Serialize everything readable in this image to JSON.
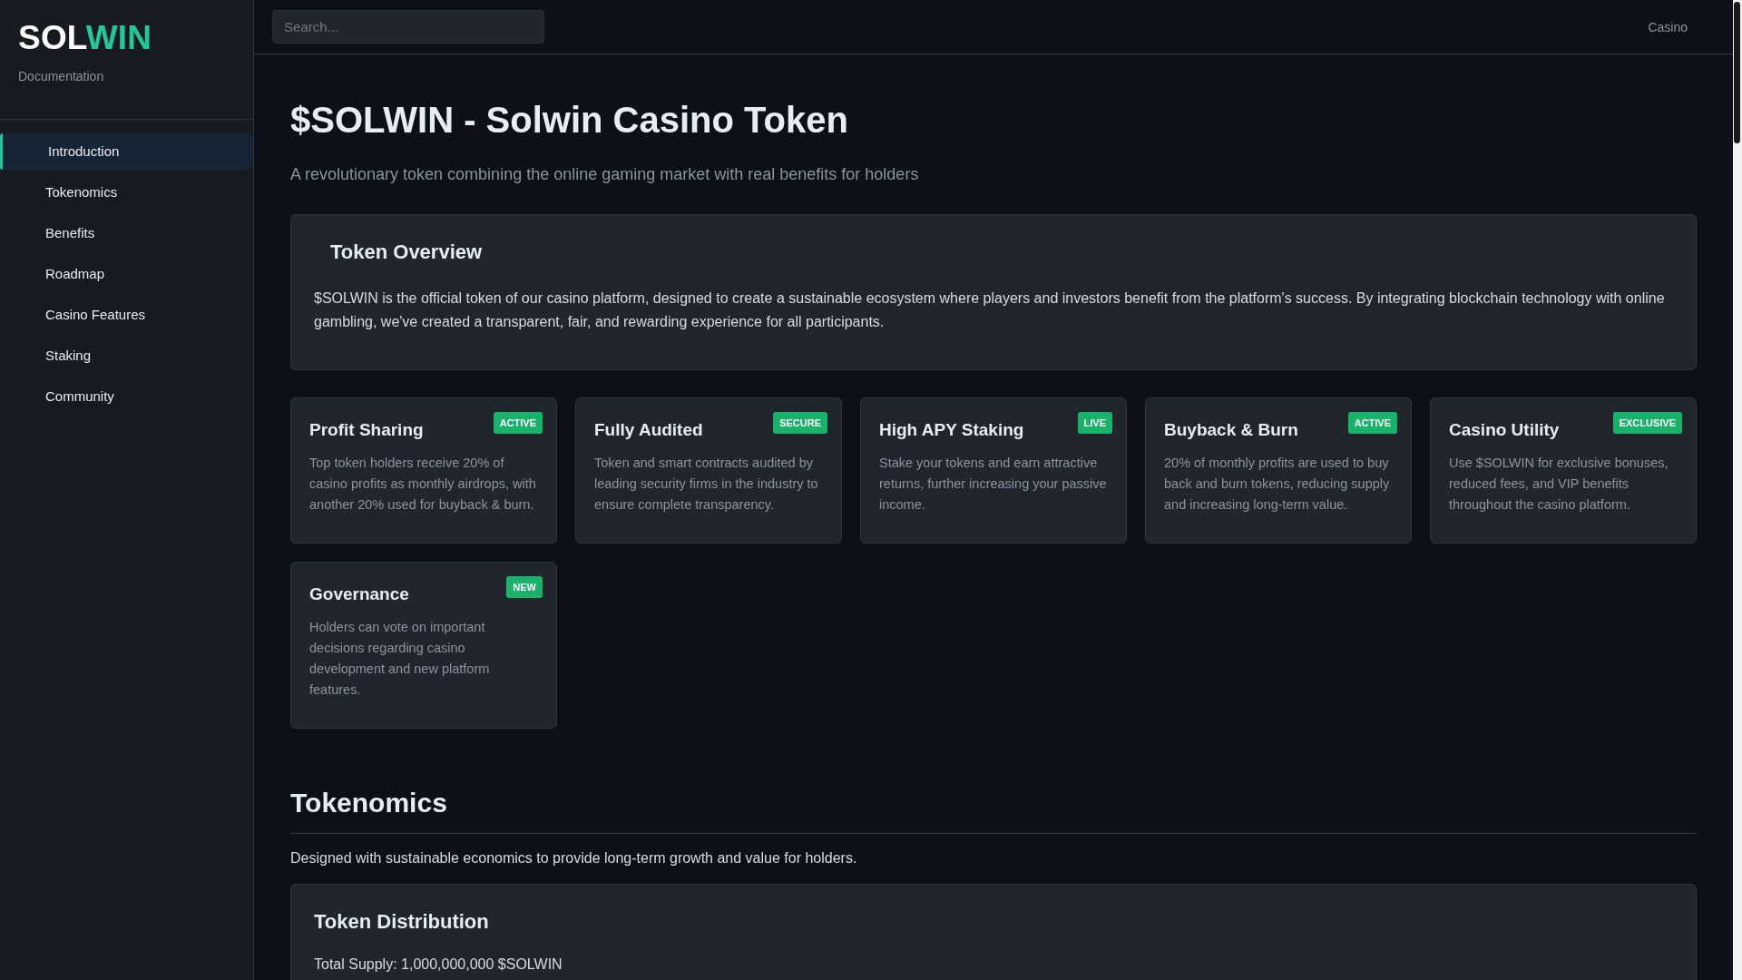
{
  "sidebar": {
    "logo": {
      "parts": [
        {
          "text": "SOL",
          "accent": false
        },
        {
          "text": "WIN",
          "accent": true
        }
      ]
    },
    "subtitle": "Documentation",
    "nav": [
      {
        "label": "Introduction",
        "selected": true
      },
      {
        "label": "Tokenomics",
        "selected": false
      },
      {
        "label": "Benefits",
        "selected": false
      },
      {
        "label": "Roadmap",
        "selected": false
      },
      {
        "label": "Casino Features",
        "selected": false
      },
      {
        "label": "Staking",
        "selected": false
      },
      {
        "label": "Community",
        "selected": false
      }
    ]
  },
  "topbar": {
    "search": {
      "placeholder": "Search..."
    },
    "links": [
      "Casino"
    ]
  },
  "page": {
    "title": "$SOLWIN - Solwin Casino Token",
    "lead": "A revolutionary token combining the online gaming market with real benefits for holders",
    "overview": {
      "title": "Token Overview",
      "text": "$SOLWIN is the official token of our casino platform, designed to create a sustainable ecosystem where players and investors benefit from the platform's success. By integrating blockchain technology with online gambling, we've created a transparent, fair, and rewarding experience for all participants."
    },
    "features": [
      {
        "title": "Profit Sharing",
        "badge": "ACTIVE",
        "text": "Top token holders receive 20% of casino profits as monthly airdrops, with another 20% used for buyback & burn."
      },
      {
        "title": "Fully Audited",
        "badge": "SECURE",
        "text": "Token and smart contracts audited by leading security firms in the industry to ensure complete transparency."
      },
      {
        "title": "High APY Staking",
        "badge": "LIVE",
        "text": "Stake your tokens and earn attractive returns, further increasing your passive income."
      },
      {
        "title": "Buyback & Burn",
        "badge": "ACTIVE",
        "text": "20% of monthly profits are used to buy back and burn tokens, reducing supply and increasing long-term value."
      },
      {
        "title": "Casino Utility",
        "badge": "EXCLUSIVE",
        "text": "Use $SOLWIN for exclusive bonuses, reduced fees, and VIP benefits throughout the casino platform."
      },
      {
        "title": "Governance",
        "badge": "NEW",
        "text": "Holders can vote on important decisions regarding casino development and new platform features."
      }
    ]
  },
  "tokenomics": {
    "title": "Tokenomics",
    "lead": "Designed with sustainable economics to provide long-term growth and value for holders.",
    "distribution": {
      "title": "Token Distribution",
      "lines": [
        "Total Supply: 1,000,000,000 $SOLWIN"
      ]
    }
  }
}
